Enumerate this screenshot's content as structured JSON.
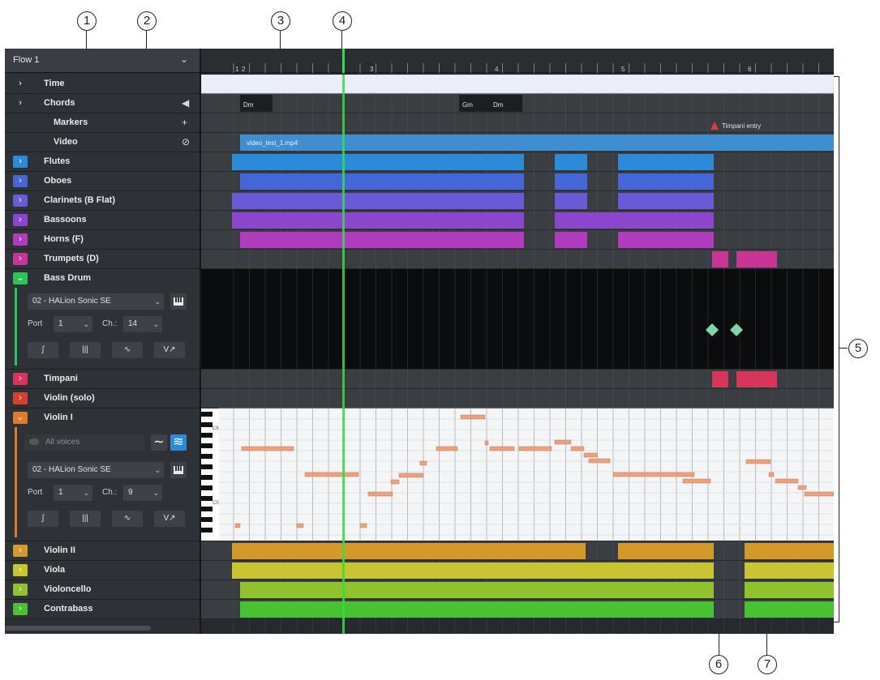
{
  "callouts": [
    "1",
    "2",
    "3",
    "4",
    "5",
    "6",
    "7"
  ],
  "flow": {
    "label": "Flow 1",
    "chevron_icon": "chevron-down-icon"
  },
  "ruler": {
    "bars": [
      "1",
      "2",
      "3",
      "4",
      "5",
      "6"
    ]
  },
  "tracks": [
    {
      "name": "Time",
      "toggle": ">",
      "color": "#2e3136"
    },
    {
      "name": "Chords",
      "toggle": ">",
      "color": "#2e3136",
      "icon": "◀"
    },
    {
      "name": "Markers",
      "color": "#2e3136",
      "icon": "+"
    },
    {
      "name": "Video",
      "color": "#2e3136",
      "icon": "⊘"
    },
    {
      "name": "Flutes",
      "toggle": ">",
      "color": "#2c8bd9"
    },
    {
      "name": "Oboes",
      "toggle": ">",
      "color": "#4466d6"
    },
    {
      "name": "Clarinets (B Flat)",
      "toggle": ">",
      "color": "#6a5ad8"
    },
    {
      "name": "Bassoons",
      "toggle": ">",
      "color": "#8b46cf"
    },
    {
      "name": "Horns (F)",
      "toggle": ">",
      "color": "#b03bbf"
    },
    {
      "name": "Trumpets (D)",
      "toggle": ">",
      "color": "#c93596"
    },
    {
      "name": "Bass Drum",
      "toggle": "v",
      "color": "#2fc25b"
    },
    {
      "name": "Timpani",
      "toggle": ">",
      "color": "#d8355c"
    },
    {
      "name": "Violin (solo)",
      "toggle": ">",
      "color": "#d7402f"
    },
    {
      "name": "Violin I",
      "toggle": "v",
      "color": "#e07a2b"
    },
    {
      "name": "Violin II",
      "toggle": ">",
      "color": "#d39a2a"
    },
    {
      "name": "Viola",
      "toggle": ">",
      "color": "#c8c530"
    },
    {
      "name": "Violoncello",
      "toggle": ">",
      "color": "#8fc22d"
    },
    {
      "name": "Contrabass",
      "toggle": ">",
      "color": "#47c232"
    }
  ],
  "bass_drum_controls": {
    "instrument": "02 - HALion Sonic SE",
    "port_label": "Port",
    "port_value": "1",
    "ch_label": "Ch.:",
    "ch_value": "14",
    "buttons": [
      "∫",
      "|||",
      "∿",
      "V↗"
    ]
  },
  "violin1_controls": {
    "voices": "All voices",
    "instrument": "02 - HALion Sonic SE",
    "port_label": "Port",
    "port_value": "1",
    "ch_label": "Ch.:",
    "ch_value": "9",
    "buttons": [
      "∫",
      "|||",
      "∿",
      "V↗"
    ]
  },
  "chords": [
    "Dm",
    "Gm",
    "Dm"
  ],
  "marker_text": "Timpani entry",
  "video_file": "video_test_1.mp4",
  "piano_labels": [
    "C6",
    "C5"
  ]
}
